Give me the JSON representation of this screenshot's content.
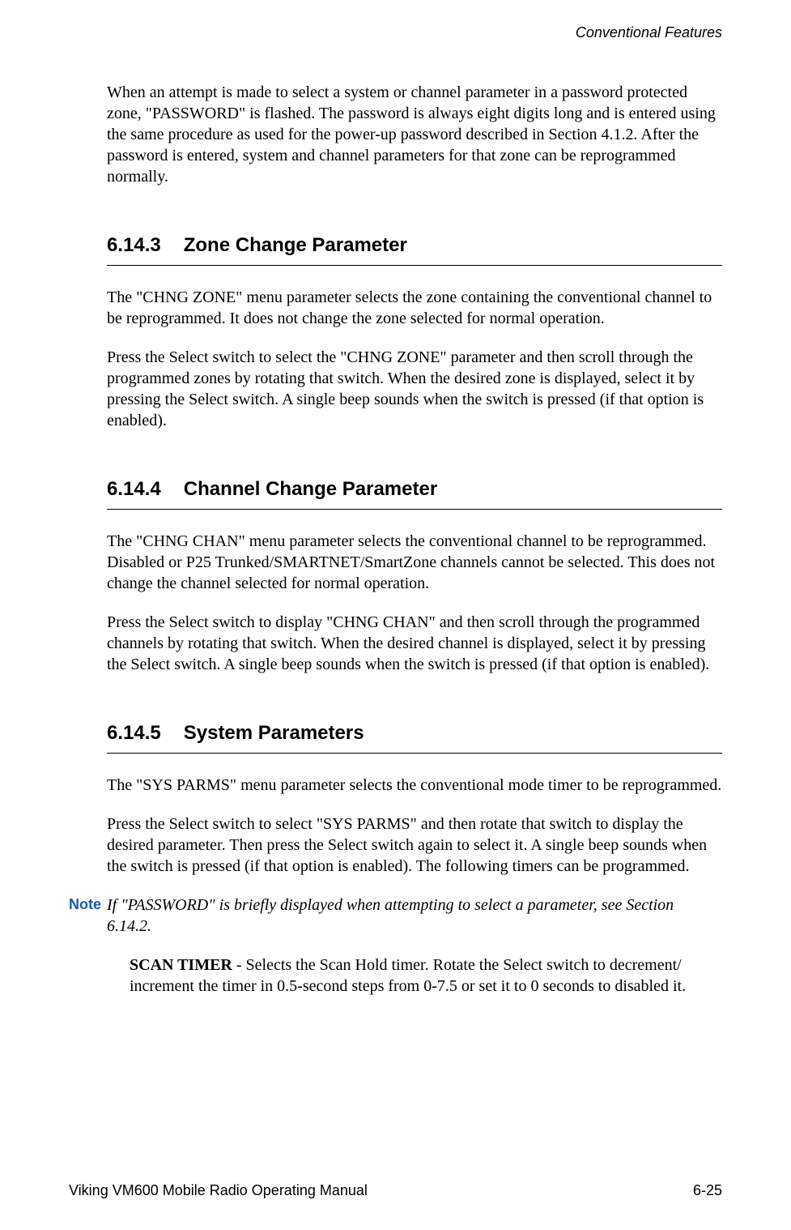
{
  "header": {
    "chapter_title": "Conventional Features"
  },
  "intro": {
    "p1": "When an attempt is made to select a system or channel parameter in a password protected zone, \"PASSWORD\" is flashed. The password is always eight digits long and is entered using the same procedure as used for the power-up password described in Section 4.1.2. After the password is entered, system and channel parameters for that zone can be reprogrammed normally."
  },
  "section1": {
    "number": "6.14.3",
    "title": "Zone Change Parameter",
    "p1": "The \"CHNG ZONE\" menu parameter selects the zone containing the conventional channel to be reprogrammed. It does not change the zone selected for normal operation.",
    "p2": "Press the Select switch to select the \"CHNG ZONE\" parameter and then scroll through the programmed zones by rotating that switch. When the desired zone is displayed, select it by pressing the Select switch. A single beep sounds when the switch is pressed (if that option is enabled)."
  },
  "section2": {
    "number": "6.14.4",
    "title": "Channel Change Parameter",
    "p1": "The \"CHNG CHAN\" menu parameter selects the conventional channel to be reprogrammed. Disabled or P25 Trunked/SMARTNET/SmartZone channels cannot be selected. This does not change the channel selected for normal operation.",
    "p2": "Press the Select switch to display \"CHNG CHAN\" and then scroll through the programmed channels by rotating that switch. When the desired channel is displayed, select it by pressing the Select switch. A single beep sounds when the switch is pressed (if that option is enabled)."
  },
  "section3": {
    "number": "6.14.5",
    "title": "System Parameters",
    "p1": "The \"SYS PARMS\" menu parameter selects the conventional mode timer to be reprogrammed.",
    "p2": "Press the Select switch to select \"SYS PARMS\" and then rotate that switch to display the desired parameter. Then press the Select switch again to select it. A single beep sounds when the switch is pressed (if that option is enabled). The following timers can be programmed.",
    "note_label": "Note",
    "note_text": "If \"PASSWORD\" is briefly displayed when attempting to select a parameter, see Section 6.14.2.",
    "item1_bold": "SCAN TIMER",
    "item1_rest": " - Selects the Scan Hold timer. Rotate the Select switch to decrement/ increment the timer in 0.5-second steps from 0-7.5 or set it to 0 seconds to disabled it."
  },
  "footer": {
    "left": "Viking VM600 Mobile Radio Operating Manual",
    "right": "6-25"
  }
}
